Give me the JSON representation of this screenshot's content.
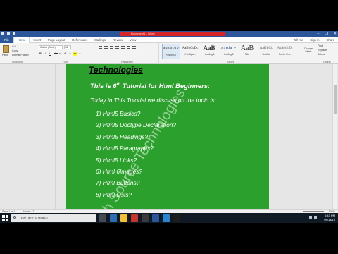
{
  "titlebar": {
    "doc_title": "Document1 - Word",
    "window_controls": [
      "–",
      "❐",
      "✕"
    ]
  },
  "tabs": {
    "file": "File",
    "items": [
      "Home",
      "Insert",
      "Page Layout",
      "References",
      "Mailings",
      "Review",
      "View"
    ],
    "right": [
      "Tell me",
      "Sign in",
      "Share"
    ]
  },
  "ribbon": {
    "clipboard": {
      "label": "Clipboard",
      "paste": "Paste",
      "cut": "Cut",
      "copy": "Copy",
      "format_painter": "Format Painter"
    },
    "font": {
      "label": "Font",
      "family": "Calibri (Body)",
      "size": "11",
      "buttons": [
        "B",
        "I",
        "U",
        "abc",
        "x₂",
        "x²",
        "A",
        "ab",
        "A"
      ]
    },
    "paragraph": {
      "label": "Paragraph"
    },
    "styles": {
      "label": "Styles",
      "items": [
        {
          "sample": "AaBbCcDc",
          "name": "¶ Normal"
        },
        {
          "sample": "AaBbCcDc",
          "name": "¶ No Spac..."
        },
        {
          "sample": "AaB",
          "name": "Heading 1"
        },
        {
          "sample": "AaBbCc",
          "name": "Heading 2"
        },
        {
          "sample": "AaB",
          "name": "Title"
        },
        {
          "sample": "AaBbCc",
          "name": "Subtitle"
        },
        {
          "sample": "AaBbCcDc",
          "name": "Subtle Em..."
        }
      ],
      "change_styles": "Change Styles"
    },
    "editing": {
      "label": "Editing",
      "find": "Find",
      "replace": "Replace",
      "select": "Select"
    }
  },
  "document": {
    "heading": "Technologies",
    "intro_pre": "This is 6",
    "intro_sup": "th",
    "intro_post": " Tutorial for Html Beginners:",
    "intro2": "Today in This Tutorial we discuss on the topic is:",
    "topics": [
      "1)  Html5  Basics?",
      "2) Html5 Doctype Declaration?",
      "3)  Html5 Headings?",
      "4)  Html5 Paragraphs?",
      "5) Html5 Links?",
      "6) Html 6Images?",
      "7) Html Buttons?",
      "8) Html Lists?"
    ],
    "watermark": "ch Source Technologies"
  },
  "statusbar": {
    "page": "Page 1 of 1",
    "words": "Words: 47",
    "zoom": "100%"
  },
  "taskbar": {
    "search_placeholder": "Type here to search",
    "time": "6:43 PM",
    "date": "09/14/19",
    "pinned_colors": [
      "#444b52",
      "#2d6db5",
      "#f2c233",
      "#c5352d",
      "#3a3a3a",
      "#2b579a",
      "#2a84d2",
      "#1d1d1d"
    ]
  }
}
